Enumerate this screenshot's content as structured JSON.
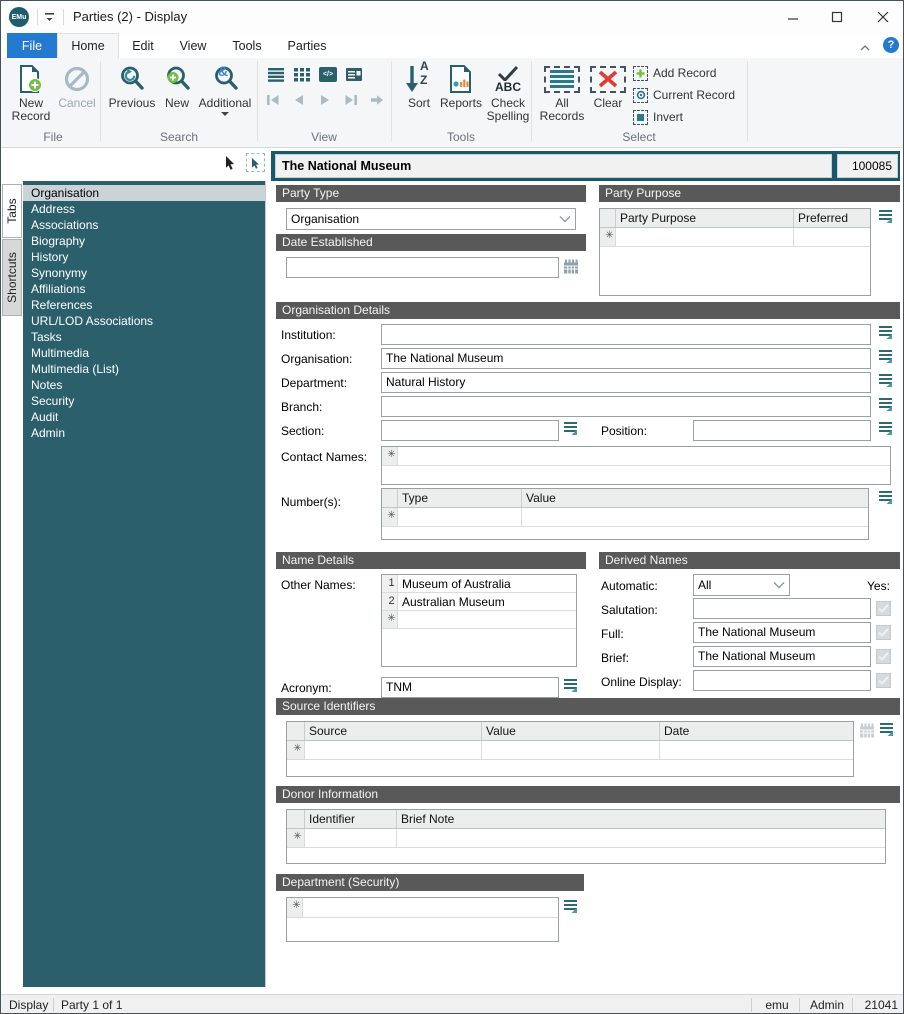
{
  "window": {
    "title": "Parties (2) - Display",
    "logo": "EMu",
    "help": "?"
  },
  "menu": {
    "file": "File",
    "home": "Home",
    "edit": "Edit",
    "view": "View",
    "tools": "Tools",
    "parties": "Parties"
  },
  "ribbon": {
    "file": {
      "label": "File",
      "new_record": "New Record",
      "cancel": "Cancel"
    },
    "search": {
      "label": "Search",
      "previous": "Previous",
      "new": "New",
      "additional": "Additional",
      "amp": "&"
    },
    "view": {
      "label": "View"
    },
    "tools": {
      "label": "Tools",
      "sort": "Sort",
      "reports": "Reports",
      "check_spelling": "Check Spelling",
      "sort_a": "A",
      "sort_z": "Z",
      "abc": "ABC"
    },
    "select": {
      "label": "Select",
      "all_records": "All Records",
      "clear": "Clear",
      "add_record": "Add Record",
      "current_record": "Current Record",
      "invert": "Invert"
    }
  },
  "record": {
    "title": "The National Museum",
    "irn": "100085"
  },
  "side_tabs": {
    "tabs": "Tabs",
    "shortcuts": "Shortcuts"
  },
  "sidebar": {
    "items": [
      {
        "label": "Organisation"
      },
      {
        "label": "Address"
      },
      {
        "label": "Associations"
      },
      {
        "label": "Biography"
      },
      {
        "label": "History"
      },
      {
        "label": "Synonymy"
      },
      {
        "label": "Affiliations"
      },
      {
        "label": "References"
      },
      {
        "label": "URL/LOD Associations"
      },
      {
        "label": "Tasks"
      },
      {
        "label": "Multimedia"
      },
      {
        "label": "Multimedia (List)"
      },
      {
        "label": "Notes"
      },
      {
        "label": "Security"
      },
      {
        "label": "Audit"
      },
      {
        "label": "Admin"
      }
    ]
  },
  "form": {
    "party_type": {
      "header": "Party Type",
      "value": "Organisation"
    },
    "date_established": {
      "header": "Date Established",
      "value": ""
    },
    "party_purpose": {
      "header": "Party Purpose",
      "col1": "Party Purpose",
      "col2": "Preferred"
    },
    "org": {
      "header": "Organisation Details",
      "institution": {
        "label": "Institution:",
        "value": ""
      },
      "organisation": {
        "label": "Organisation:",
        "value": "The National Museum"
      },
      "department": {
        "label": "Department:",
        "value": "Natural History"
      },
      "branch": {
        "label": "Branch:",
        "value": ""
      },
      "section": {
        "label": "Section:",
        "value": ""
      },
      "position": {
        "label": "Position:",
        "value": ""
      },
      "contact_names": {
        "label": "Contact Names:"
      },
      "numbers": {
        "label": "Number(s):",
        "col1": "Type",
        "col2": "Value"
      }
    },
    "name_details": {
      "header": "Name Details",
      "other_names": "Other Names:",
      "rows": [
        {
          "n": "1",
          "v": "Museum of Australia"
        },
        {
          "n": "2",
          "v": "Australian Museum"
        }
      ],
      "acronym_label": "Acronym:",
      "acronym": "TNM"
    },
    "derived": {
      "header": "Derived Names",
      "automatic": "Automatic:",
      "automatic_value": "All",
      "yes": "Yes:",
      "salutation": "Salutation:",
      "salutation_value": "",
      "full": "Full:",
      "full_value": "The National Museum",
      "brief": "Brief:",
      "brief_value": "The National Museum",
      "online": "Online Display:",
      "online_value": ""
    },
    "source": {
      "header": "Source Identifiers",
      "col1": "Source",
      "col2": "Value",
      "col3": "Date"
    },
    "donor": {
      "header": "Donor Information",
      "col1": "Identifier",
      "col2": "Brief Note"
    },
    "dept_sec": {
      "header": "Department (Security)"
    }
  },
  "status": {
    "mode": "Display",
    "record_count": "Party 1 of 1",
    "user": "emu",
    "group": "Admin",
    "pid": "21041"
  },
  "misc": {
    "new_row": "✳",
    "code_glyph": "</>"
  },
  "colors": {
    "teal": "#2b5f6c",
    "band_teal": "#19586a",
    "accent_blue": "#2479d0",
    "green": "#72bf44",
    "red": "#e03c31",
    "section_gray": "#595959"
  }
}
